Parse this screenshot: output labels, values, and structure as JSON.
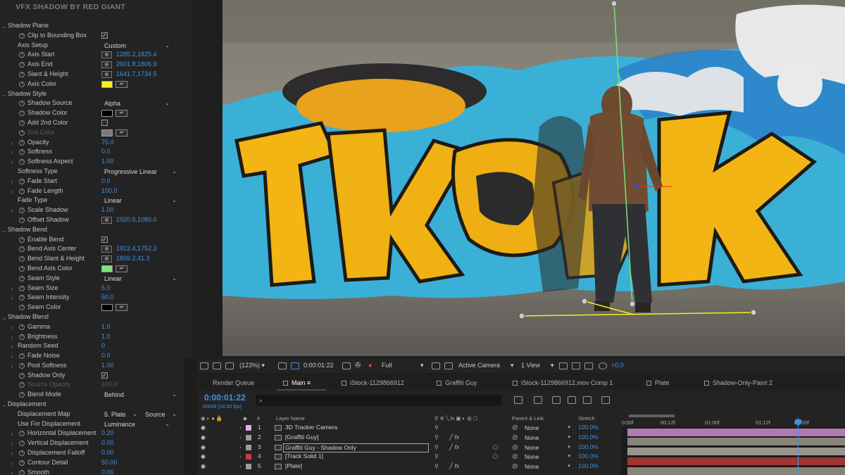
{
  "effect": {
    "title": "VFX SHADOW BY RED GIANT",
    "rows": [
      {
        "kind": "group",
        "label": "Shadow Plane"
      },
      {
        "kind": "check",
        "label": "Clip to Bounding Box",
        "checked": true
      },
      {
        "kind": "select",
        "label": "Axis Setup",
        "value": "Custom"
      },
      {
        "kind": "point",
        "label": "Axis Start",
        "value": "1285.2,1825.4"
      },
      {
        "kind": "point",
        "label": "Axis End",
        "value": "2601.8,1806.9"
      },
      {
        "kind": "point",
        "label": "Slant & Height",
        "value": "1641.7,1734.5"
      },
      {
        "kind": "color",
        "label": "Axis Color",
        "color": "#f3f01a"
      },
      {
        "kind": "group",
        "label": "Shadow Style"
      },
      {
        "kind": "select",
        "label": "Shadow Source",
        "value": "Alpha"
      },
      {
        "kind": "color",
        "label": "Shadow Color",
        "color": "#000000"
      },
      {
        "kind": "check",
        "label": "Add 2nd Color",
        "checked": false
      },
      {
        "kind": "color",
        "label": "2nd Color",
        "color": "#7a7a7a",
        "disabled": true
      },
      {
        "kind": "num",
        "label": "Opacity",
        "value": "75.0",
        "twirl": true
      },
      {
        "kind": "num",
        "label": "Softness",
        "value": "0.0",
        "twirl": true
      },
      {
        "kind": "num",
        "label": "Softness Aspect",
        "value": "1.00",
        "twirl": true
      },
      {
        "kind": "select",
        "label": "Softness Type",
        "value": "Progressive Linear",
        "wide": true
      },
      {
        "kind": "num",
        "label": "Fade Start",
        "value": "0.0",
        "twirl": true
      },
      {
        "kind": "num",
        "label": "Fade Length",
        "value": "100.0",
        "twirl": true
      },
      {
        "kind": "select",
        "label": "Fade Type",
        "value": "Linear",
        "wide": true
      },
      {
        "kind": "num",
        "label": "Scale Shadow",
        "value": "1.00",
        "twirl": true
      },
      {
        "kind": "point",
        "label": "Offset Shadow",
        "value": "1920.0,1080.0"
      },
      {
        "kind": "group",
        "label": "Shadow Bend"
      },
      {
        "kind": "check",
        "label": "Enable Bend",
        "checked": true
      },
      {
        "kind": "point",
        "label": "Bend Axis Center",
        "value": "1912.4,1752.3"
      },
      {
        "kind": "point",
        "label": "Bend Slant & Height",
        "value": "1809.2,41.3"
      },
      {
        "kind": "color",
        "label": "Bend Axis Color",
        "color": "#7ee07e"
      },
      {
        "kind": "select",
        "label": "Seam Style",
        "value": "Linear",
        "wide": true
      },
      {
        "kind": "num",
        "label": "Seam Size",
        "value": "5.0",
        "twirl": true
      },
      {
        "kind": "num",
        "label": "Seam Intensity",
        "value": "50.0",
        "twirl": true
      },
      {
        "kind": "color",
        "label": "Seam Color",
        "color": "#000000"
      },
      {
        "kind": "group",
        "label": "Shadow Blend"
      },
      {
        "kind": "num",
        "label": "Gamma",
        "value": "1.0",
        "twirl": true
      },
      {
        "kind": "num",
        "label": "Brightness",
        "value": "1.0",
        "twirl": true
      },
      {
        "kind": "num",
        "label": "Random Seed",
        "value": "0",
        "twirl": true,
        "nostop": true
      },
      {
        "kind": "num",
        "label": "Fade Noise",
        "value": "0.0",
        "twirl": true
      },
      {
        "kind": "num",
        "label": "Post Softness",
        "value": "1.00",
        "twirl": true
      },
      {
        "kind": "check",
        "label": "Shadow Only",
        "checked": true
      },
      {
        "kind": "num",
        "label": "Source Opacity",
        "value": "100.0",
        "disabled": true
      },
      {
        "kind": "select",
        "label": "Blend Mode",
        "value": "Behind",
        "wide": true
      },
      {
        "kind": "group",
        "label": "Displacement"
      },
      {
        "kind": "select2",
        "label": "Displacement Map",
        "value": "5. Plate",
        "value2": "Source",
        "nostop": true
      },
      {
        "kind": "select",
        "label": "Use For Displacement",
        "value": "Luminance",
        "nostop": true
      },
      {
        "kind": "num",
        "label": "Horizontal Displacement",
        "value": "0.20",
        "twirl": true
      },
      {
        "kind": "num",
        "label": "Vertical Displacement",
        "value": "0.00",
        "twirl": true
      },
      {
        "kind": "num",
        "label": "Displacement Falloff",
        "value": "0.00",
        "twirl": true
      },
      {
        "kind": "num",
        "label": "Contour Detail",
        "value": "50.00",
        "twirl": true
      },
      {
        "kind": "num",
        "label": "Smooth",
        "value": "0.00",
        "twirl": true
      }
    ]
  },
  "viewer_toolbar": {
    "zoom": "(123%)",
    "timecode": "0:00:01:22",
    "resolution": "Full",
    "camera": "Active Camera",
    "views": "1 View",
    "exposure": "+0.0"
  },
  "tabs": [
    {
      "label": "Render Queue",
      "active": false
    },
    {
      "label": "Main",
      "active": true
    },
    {
      "label": "iStock-1129866912",
      "active": false
    },
    {
      "label": "Graffiti Guy",
      "active": false
    },
    {
      "label": "iStock-1129866912.mov Comp 1",
      "active": false
    },
    {
      "label": "Plate",
      "active": false
    },
    {
      "label": "Shadow-Only-Paint 2",
      "active": false
    }
  ],
  "timeline": {
    "timecode": "0:00:01:22",
    "frames": "00046 (24.00 fps)",
    "search_placeholder": "",
    "columns": {
      "name": "Layer Name",
      "parent": "Parent & Link",
      "stretch": "Stretch",
      "num": "#"
    },
    "ruler": [
      "0:00f",
      "00:12f",
      "01:00f",
      "01:12f",
      "02:00f"
    ],
    "layers": [
      {
        "num": "1",
        "name": "3D Tracker Camera",
        "label_color": "#e8a8e8",
        "bar_color": "#b07ab0",
        "parent": "None",
        "stretch": "100.0%",
        "fx": false,
        "cube": false
      },
      {
        "num": "2",
        "name": "[Graffiti Guy]",
        "label_color": "#a39b90",
        "bar_color": "#8a8378",
        "parent": "None",
        "stretch": "100.0%",
        "fx": true,
        "cube": false
      },
      {
        "num": "3",
        "name": "Graffiti Guy - Shadow Only",
        "label_color": "#a39b90",
        "bar_color": "#9a958c",
        "parent": "None",
        "stretch": "100.0%",
        "fx": true,
        "cube": true,
        "selected": true
      },
      {
        "num": "4",
        "name": "[Track Solid 1]",
        "label_color": "#cc3b3b",
        "bar_color": "#a33434",
        "parent": "None",
        "stretch": "100.0%",
        "fx": false,
        "cube": true
      },
      {
        "num": "5",
        "name": "[Plate]",
        "label_color": "#a39b90",
        "bar_color": "#8a8378",
        "parent": "None",
        "stretch": "100.0%",
        "fx": true,
        "cube": false
      }
    ]
  }
}
